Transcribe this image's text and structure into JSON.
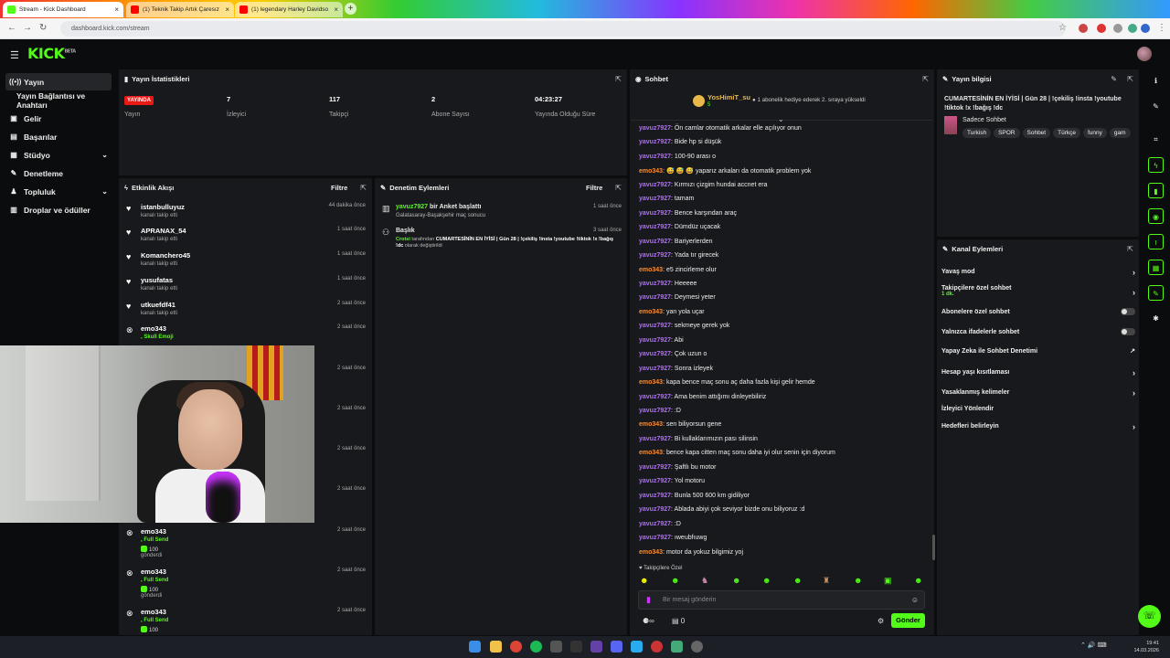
{
  "browser": {
    "tabs": [
      {
        "label": "Stream - Kick Dashboard",
        "active": true
      },
      {
        "label": "(1) Teknik Takip Artık Çaresız",
        "active": false
      },
      {
        "label": "(1) legendary Harley Davidson",
        "active": false
      }
    ],
    "url": "dashboard.kick.com/stream"
  },
  "header": {
    "logo": "KICK",
    "logo_sup": "BETA"
  },
  "sidebar": {
    "items": [
      {
        "label": "Yayın",
        "icon": "broadcast-icon"
      },
      {
        "label": "Yayın Bağlantısı ve Anahtarı",
        "icon": ""
      },
      {
        "label": "Gelir",
        "icon": "money-icon"
      },
      {
        "label": "Başarılar",
        "icon": "trophy-icon"
      },
      {
        "label": "Stüdyo",
        "icon": "studio-icon"
      },
      {
        "label": "Denetleme",
        "icon": "wrench-icon"
      },
      {
        "label": "Topluluk",
        "icon": "community-icon"
      },
      {
        "label": "Droplar ve ödüller",
        "icon": "gift-icon"
      }
    ]
  },
  "stats": {
    "title": "Yayın İstatistikleri",
    "live_badge": "YAYINDA",
    "items": [
      {
        "value": "",
        "label": "Yayın"
      },
      {
        "value": "7",
        "label": "İzleyici"
      },
      {
        "value": "117",
        "label": "Takipçi"
      },
      {
        "value": "2",
        "label": "Abone Sayısı"
      },
      {
        "value": "04:23:27",
        "label": "Yayında Olduğu Süre"
      }
    ]
  },
  "activity": {
    "title": "Etkinlik Akışı",
    "filter": "Filtre",
    "events": [
      {
        "name": "istanbulluyuz",
        "sub": "kanalı takip etti",
        "time": "44 dakika önce"
      },
      {
        "name": "APRANAX_54",
        "sub": "kanalı takip etti",
        "time": "1 saat önce"
      },
      {
        "name": "Komanchero45",
        "sub": "kanalı takip etti",
        "time": "1 saat önce"
      },
      {
        "name": "yusufatas",
        "sub": "kanalı takip etti",
        "time": "1 saat önce"
      },
      {
        "name": "utkuefdf41",
        "sub": "kanalı takip etti",
        "time": "2 saat önce"
      },
      {
        "name": "emo343",
        "gift": ", Skull Emoji",
        "time": "2 saat önce"
      }
    ],
    "hidden_times": [
      "2 saat önce",
      "2 saat önce",
      "2 saat önce",
      "2 saat önce",
      "2 saat önce"
    ],
    "bottom_events": [
      {
        "name": "emo343",
        "gift": ", Full Send",
        "amount": "100",
        "sent": "gönderdi",
        "time": "2 saat önce"
      },
      {
        "name": "emo343",
        "gift": ", Full Send",
        "amount": "100",
        "sent": "gönderdi",
        "time": "2 saat önce"
      },
      {
        "name": "emo343",
        "gift": ", Full Send",
        "amount": "100",
        "sent": "",
        "time": "2 saat önce"
      }
    ]
  },
  "moderation": {
    "title": "Denetim Eylemleri",
    "filter": "Filtre",
    "items": [
      {
        "user": "yavuz7927",
        "action": " bir Anket başlattı",
        "detail": "Galatasaray-Başakşehir maç sonucu",
        "time": "1 saat önce"
      },
      {
        "user": "Başlık",
        "action": "",
        "detail_user": "Crotsi",
        "detail_pre": " tarafından ",
        "detail_title": "CUMARTESİNİN EN İYİSİ | Gün 28 | !çekiliş !insta !youtube !tiktok !x !bağış !dc",
        "detail_post": " olarak değiştirildi",
        "time": "3 saat önce"
      }
    ]
  },
  "chat": {
    "title": "Sohbet",
    "pinned_user": "YosHimiT_su",
    "pinned_badge": "5",
    "pinned_text": "1 abonelik hediye ederek 2. sıraya yükseldi",
    "messages": [
      {
        "u": "yavuz7927",
        "c": "c1",
        "t": ": Ön camlar otomatik arkalar elle açılıyor onun"
      },
      {
        "u": "yavuz7927",
        "c": "c1",
        "t": ": Bide hp si düşük"
      },
      {
        "u": "yavuz7927",
        "c": "c1",
        "t": ": 100-90 arası o"
      },
      {
        "u": "emo343",
        "c": "c2",
        "t": ": 😅 😅 😅 yaparız arkaları da otomatik problem yok"
      },
      {
        "u": "yavuz7927",
        "c": "c1",
        "t": ": Kırmızı çizgim hundai accnet era"
      },
      {
        "u": "yavuz7927",
        "c": "c1",
        "t": ": tamam"
      },
      {
        "u": "yavuz7927",
        "c": "c1",
        "t": ": Bence karşından araç"
      },
      {
        "u": "yavuz7927",
        "c": "c1",
        "t": ": Dümdüz uçacak"
      },
      {
        "u": "yavuz7927",
        "c": "c1",
        "t": ": Bariyerlerden"
      },
      {
        "u": "yavuz7927",
        "c": "c1",
        "t": ": Yada tır girecek"
      },
      {
        "u": "emo343",
        "c": "c2",
        "t": ": e5 zincirleme olur"
      },
      {
        "u": "yavuz7927",
        "c": "c1",
        "t": ": Heeeee"
      },
      {
        "u": "yavuz7927",
        "c": "c1",
        "t": ": Deymesi yeter"
      },
      {
        "u": "emo343",
        "c": "c2",
        "t": ": yan yola uçar"
      },
      {
        "u": "yavuz7927",
        "c": "c1",
        "t": ": sekmeye gerek yok"
      },
      {
        "u": "yavuz7927",
        "c": "c1",
        "t": ": Abi"
      },
      {
        "u": "yavuz7927",
        "c": "c1",
        "t": ": Çok uzun o"
      },
      {
        "u": "yavuz7927",
        "c": "c1",
        "t": ": Sonra izleyek"
      },
      {
        "u": "emo343",
        "c": "c2",
        "t": ": kapa bence maç sonu aç daha fazla kişi gelir hemde"
      },
      {
        "u": "yavuz7927",
        "c": "c1",
        "t": ": Ama benim attığımı dinleyebiliriz"
      },
      {
        "u": "yavuz7927",
        "c": "c1",
        "t": ": :D"
      },
      {
        "u": "emo343",
        "c": "c2",
        "t": ": sen biliyorsun gene"
      },
      {
        "u": "yavuz7927",
        "c": "c1",
        "t": ": Bi kullaklarımızın pası silinsin"
      },
      {
        "u": "emo343",
        "c": "c2",
        "t": ": bence kapa citten maç sonu daha iyi olur senin için diyorum"
      },
      {
        "u": "yavuz7927",
        "c": "c1",
        "t": ": Şaftlı bu motor"
      },
      {
        "u": "yavuz7927",
        "c": "c1",
        "t": ": Yol motoru"
      },
      {
        "u": "yavuz7927",
        "c": "c1",
        "t": ": Bunla 500 600 km gidiliyor"
      },
      {
        "u": "yavuz7927",
        "c": "c1",
        "t": ": Ablada abiyi çok seviyor bizde onu biliyoruz :d"
      },
      {
        "u": "yavuz7927",
        "c": "c1",
        "t": ": :D"
      },
      {
        "u": "yavuz7927",
        "c": "c1",
        "t": ": ıweubfıuwg"
      },
      {
        "u": "emo343",
        "c": "c2",
        "t": ": motor da yokuz bilgimiz yoj"
      }
    ],
    "followers_only": "Takipçilere Özel",
    "input_placeholder": "Bir mesaj gönderin",
    "count": "0",
    "send_label": "Gönder"
  },
  "stream_info": {
    "title": "Yayın bilgisi",
    "stream_title": "CUMARTESİNİN EN İYİSİ | Gün 28 | !çekiliş !insta !youtube !tiktok !x !bağış !dc",
    "category": "Sadece Sohbet",
    "tags": [
      "Turkish",
      "SPOR",
      "Sohbet",
      "Türkçe",
      "funny",
      "gam"
    ]
  },
  "channel_actions": {
    "title": "Kanal Eylemleri",
    "items": [
      {
        "label": "Yavaş mod",
        "kind": "arrow"
      },
      {
        "label": "Takipçilere özel sohbet",
        "sub": "1 dk.",
        "kind": "arrow"
      },
      {
        "label": "Abonelere özel sohbet",
        "kind": "toggle"
      },
      {
        "label": "Yalnızca ifadelerle sohbet",
        "kind": "toggle"
      },
      {
        "label": "Yapay Zeka ile Sohbet Denetimi",
        "kind": "external"
      },
      {
        "label": "Hesap yaşı kısıtlaması",
        "kind": "arrow"
      },
      {
        "label": "Yasaklanmış kelimeler",
        "kind": "arrow"
      },
      {
        "label": "İzleyici Yönlendir",
        "kind": "none"
      },
      {
        "label": "Hedefleri belirleyin",
        "kind": "arrow"
      }
    ]
  },
  "taskbar": {
    "time": "19:41",
    "date": "14.03.2026"
  },
  "colors": {
    "accent": "#53fc18",
    "live": "#e91916",
    "panel": "#18191c",
    "bg": "#0b0c0d"
  }
}
